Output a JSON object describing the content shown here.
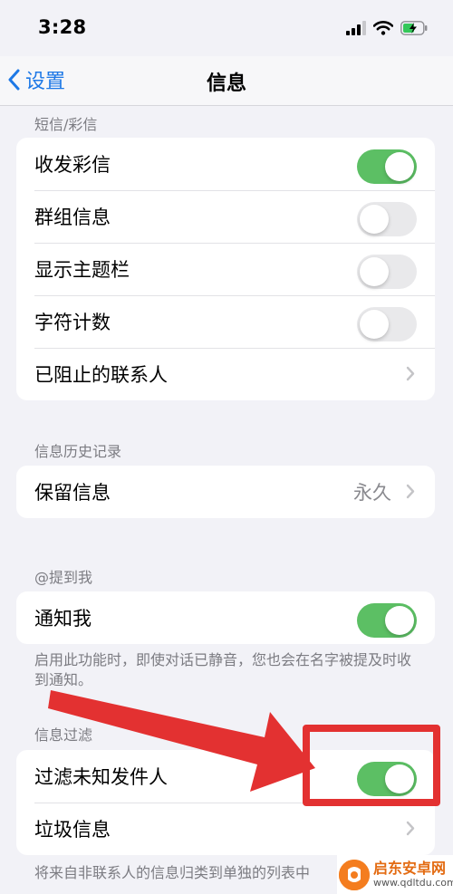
{
  "status_bar": {
    "time": "3:28"
  },
  "nav": {
    "back_label": "设置",
    "title": "信息"
  },
  "sections": [
    {
      "header": "短信/彩信",
      "rows": [
        {
          "label": "收发彩信",
          "type": "toggle",
          "on": true
        },
        {
          "label": "群组信息",
          "type": "toggle",
          "on": false
        },
        {
          "label": "显示主题栏",
          "type": "toggle",
          "on": false
        },
        {
          "label": "字符计数",
          "type": "toggle",
          "on": false
        },
        {
          "label": "已阻止的联系人",
          "type": "link"
        }
      ]
    },
    {
      "header": "信息历史记录",
      "rows": [
        {
          "label": "保留信息",
          "type": "link",
          "value": "永久"
        }
      ]
    },
    {
      "header": "@提到我",
      "rows": [
        {
          "label": "通知我",
          "type": "toggle",
          "on": true
        }
      ],
      "footer": "启用此功能时，即使对话已静音，您也会在名字被提及时收到通知。"
    },
    {
      "header": "信息过滤",
      "rows": [
        {
          "label": "过滤未知发件人",
          "type": "toggle",
          "on": true
        },
        {
          "label": "垃圾信息",
          "type": "link"
        }
      ],
      "footer": "将来自非联系人的信息归类到单独的列表中"
    }
  ],
  "watermark": {
    "title": "启东安卓网",
    "url": "www.qdltdu.com"
  },
  "colors": {
    "accent": "#1d78e6",
    "toggle_on": "#5cbf64",
    "annotation": "#e33131"
  }
}
